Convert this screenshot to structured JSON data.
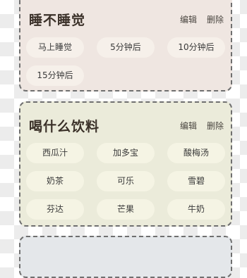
{
  "cards": [
    {
      "title": "睡不睡觉",
      "actions": {
        "edit": "编辑",
        "delete": "删除"
      },
      "options": [
        "马上睡觉",
        "5分钟后",
        "10分钟后",
        "15分钟后"
      ]
    },
    {
      "title": "喝什么饮料",
      "actions": {
        "edit": "编辑",
        "delete": "删除"
      },
      "options": [
        "西瓜汁",
        "加多宝",
        "酸梅汤",
        "奶茶",
        "可乐",
        "雪碧",
        "芬达",
        "芒果",
        "牛奶"
      ]
    }
  ],
  "colors": {
    "card_sleep_bg": "#efe6e1",
    "card_drink_bg": "#ebebda",
    "card_third_bg": "#e4e7ea",
    "chip_sleep_bg": "#f6f0ea",
    "chip_drink_bg": "#f5f4e4",
    "border": "#6f6f6f"
  }
}
